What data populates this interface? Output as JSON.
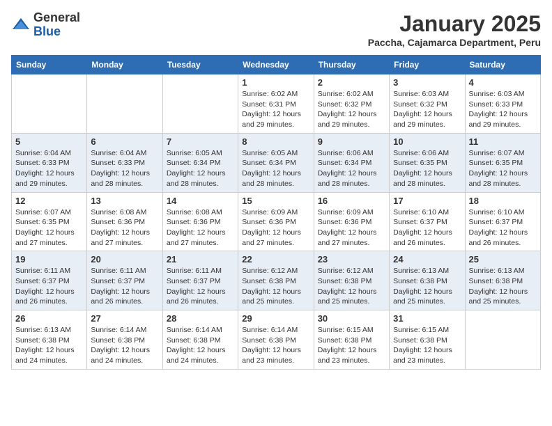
{
  "logo": {
    "general": "General",
    "blue": "Blue"
  },
  "header": {
    "title": "January 2025",
    "subtitle": "Paccha, Cajamarca Department, Peru"
  },
  "weekdays": [
    "Sunday",
    "Monday",
    "Tuesday",
    "Wednesday",
    "Thursday",
    "Friday",
    "Saturday"
  ],
  "weeks": [
    [
      null,
      null,
      null,
      {
        "day": "1",
        "sunrise": "Sunrise: 6:02 AM",
        "sunset": "Sunset: 6:31 PM",
        "daylight": "Daylight: 12 hours and 29 minutes."
      },
      {
        "day": "2",
        "sunrise": "Sunrise: 6:02 AM",
        "sunset": "Sunset: 6:32 PM",
        "daylight": "Daylight: 12 hours and 29 minutes."
      },
      {
        "day": "3",
        "sunrise": "Sunrise: 6:03 AM",
        "sunset": "Sunset: 6:32 PM",
        "daylight": "Daylight: 12 hours and 29 minutes."
      },
      {
        "day": "4",
        "sunrise": "Sunrise: 6:03 AM",
        "sunset": "Sunset: 6:33 PM",
        "daylight": "Daylight: 12 hours and 29 minutes."
      }
    ],
    [
      {
        "day": "5",
        "sunrise": "Sunrise: 6:04 AM",
        "sunset": "Sunset: 6:33 PM",
        "daylight": "Daylight: 12 hours and 29 minutes."
      },
      {
        "day": "6",
        "sunrise": "Sunrise: 6:04 AM",
        "sunset": "Sunset: 6:33 PM",
        "daylight": "Daylight: 12 hours and 28 minutes."
      },
      {
        "day": "7",
        "sunrise": "Sunrise: 6:05 AM",
        "sunset": "Sunset: 6:34 PM",
        "daylight": "Daylight: 12 hours and 28 minutes."
      },
      {
        "day": "8",
        "sunrise": "Sunrise: 6:05 AM",
        "sunset": "Sunset: 6:34 PM",
        "daylight": "Daylight: 12 hours and 28 minutes."
      },
      {
        "day": "9",
        "sunrise": "Sunrise: 6:06 AM",
        "sunset": "Sunset: 6:34 PM",
        "daylight": "Daylight: 12 hours and 28 minutes."
      },
      {
        "day": "10",
        "sunrise": "Sunrise: 6:06 AM",
        "sunset": "Sunset: 6:35 PM",
        "daylight": "Daylight: 12 hours and 28 minutes."
      },
      {
        "day": "11",
        "sunrise": "Sunrise: 6:07 AM",
        "sunset": "Sunset: 6:35 PM",
        "daylight": "Daylight: 12 hours and 28 minutes."
      }
    ],
    [
      {
        "day": "12",
        "sunrise": "Sunrise: 6:07 AM",
        "sunset": "Sunset: 6:35 PM",
        "daylight": "Daylight: 12 hours and 27 minutes."
      },
      {
        "day": "13",
        "sunrise": "Sunrise: 6:08 AM",
        "sunset": "Sunset: 6:36 PM",
        "daylight": "Daylight: 12 hours and 27 minutes."
      },
      {
        "day": "14",
        "sunrise": "Sunrise: 6:08 AM",
        "sunset": "Sunset: 6:36 PM",
        "daylight": "Daylight: 12 hours and 27 minutes."
      },
      {
        "day": "15",
        "sunrise": "Sunrise: 6:09 AM",
        "sunset": "Sunset: 6:36 PM",
        "daylight": "Daylight: 12 hours and 27 minutes."
      },
      {
        "day": "16",
        "sunrise": "Sunrise: 6:09 AM",
        "sunset": "Sunset: 6:36 PM",
        "daylight": "Daylight: 12 hours and 27 minutes."
      },
      {
        "day": "17",
        "sunrise": "Sunrise: 6:10 AM",
        "sunset": "Sunset: 6:37 PM",
        "daylight": "Daylight: 12 hours and 26 minutes."
      },
      {
        "day": "18",
        "sunrise": "Sunrise: 6:10 AM",
        "sunset": "Sunset: 6:37 PM",
        "daylight": "Daylight: 12 hours and 26 minutes."
      }
    ],
    [
      {
        "day": "19",
        "sunrise": "Sunrise: 6:11 AM",
        "sunset": "Sunset: 6:37 PM",
        "daylight": "Daylight: 12 hours and 26 minutes."
      },
      {
        "day": "20",
        "sunrise": "Sunrise: 6:11 AM",
        "sunset": "Sunset: 6:37 PM",
        "daylight": "Daylight: 12 hours and 26 minutes."
      },
      {
        "day": "21",
        "sunrise": "Sunrise: 6:11 AM",
        "sunset": "Sunset: 6:37 PM",
        "daylight": "Daylight: 12 hours and 26 minutes."
      },
      {
        "day": "22",
        "sunrise": "Sunrise: 6:12 AM",
        "sunset": "Sunset: 6:38 PM",
        "daylight": "Daylight: 12 hours and 25 minutes."
      },
      {
        "day": "23",
        "sunrise": "Sunrise: 6:12 AM",
        "sunset": "Sunset: 6:38 PM",
        "daylight": "Daylight: 12 hours and 25 minutes."
      },
      {
        "day": "24",
        "sunrise": "Sunrise: 6:13 AM",
        "sunset": "Sunset: 6:38 PM",
        "daylight": "Daylight: 12 hours and 25 minutes."
      },
      {
        "day": "25",
        "sunrise": "Sunrise: 6:13 AM",
        "sunset": "Sunset: 6:38 PM",
        "daylight": "Daylight: 12 hours and 25 minutes."
      }
    ],
    [
      {
        "day": "26",
        "sunrise": "Sunrise: 6:13 AM",
        "sunset": "Sunset: 6:38 PM",
        "daylight": "Daylight: 12 hours and 24 minutes."
      },
      {
        "day": "27",
        "sunrise": "Sunrise: 6:14 AM",
        "sunset": "Sunset: 6:38 PM",
        "daylight": "Daylight: 12 hours and 24 minutes."
      },
      {
        "day": "28",
        "sunrise": "Sunrise: 6:14 AM",
        "sunset": "Sunset: 6:38 PM",
        "daylight": "Daylight: 12 hours and 24 minutes."
      },
      {
        "day": "29",
        "sunrise": "Sunrise: 6:14 AM",
        "sunset": "Sunset: 6:38 PM",
        "daylight": "Daylight: 12 hours and 23 minutes."
      },
      {
        "day": "30",
        "sunrise": "Sunrise: 6:15 AM",
        "sunset": "Sunset: 6:38 PM",
        "daylight": "Daylight: 12 hours and 23 minutes."
      },
      {
        "day": "31",
        "sunrise": "Sunrise: 6:15 AM",
        "sunset": "Sunset: 6:38 PM",
        "daylight": "Daylight: 12 hours and 23 minutes."
      },
      null
    ]
  ]
}
